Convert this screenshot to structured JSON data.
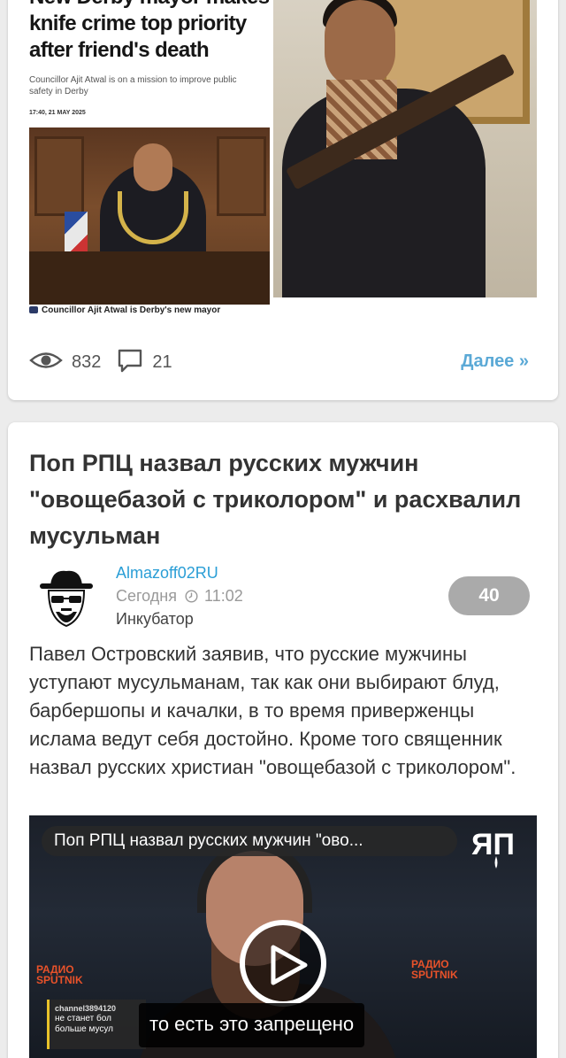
{
  "post1": {
    "news_image": {
      "headline_lines": [
        "New Derby mayor makes",
        "knife crime top priority",
        "after friend's death"
      ],
      "subhead": "Councillor Ajit Atwal is on a mission to improve public safety in Derby",
      "timestamp": "17:40, 21 MAY 2025",
      "caption": "Councillor Ajit Atwal is Derby's new mayor"
    },
    "stats": {
      "views": "832",
      "comments": "21"
    },
    "more_label": "Далее »"
  },
  "post2": {
    "title": "Поп РПЦ назвал русских мужчин \"овощебазой с триколором\" и расхвалил мусульман",
    "author": {
      "name": "Almazoff02RU",
      "date": "Сегодня",
      "time": "11:02",
      "group": "Инкубатор"
    },
    "rating": "40",
    "text": "Павел Островский заявив, что русские мужчины уступают мусульманам, так как они выбирают блуд, барбершопы и качалки, в то время приверженцы ислама ведут себя достойно. Кроме того священник назвал русских христиан \"овощебазой с триколором\".",
    "video": {
      "title": "Поп РПЦ назвал русских мужчин \"ово...",
      "logo_text": "ЯП",
      "subtitle": "то есть это запрещено",
      "channel_name": "channel3894120",
      "channel_text": "не станет бол\nбольше мусул",
      "watermark_left": "РАДИО\nSPUTNIK",
      "watermark_right": "РАДИО\nSPUTNIK"
    }
  },
  "colors": {
    "link_blue": "#2a9ed6",
    "more_blue": "#5ba9d6",
    "badge_gray": "#aaaaaa",
    "page_bg": "#ececec"
  },
  "icons": [
    "eye-icon",
    "comment-icon",
    "clock-icon",
    "play-icon",
    "camera-icon"
  ]
}
